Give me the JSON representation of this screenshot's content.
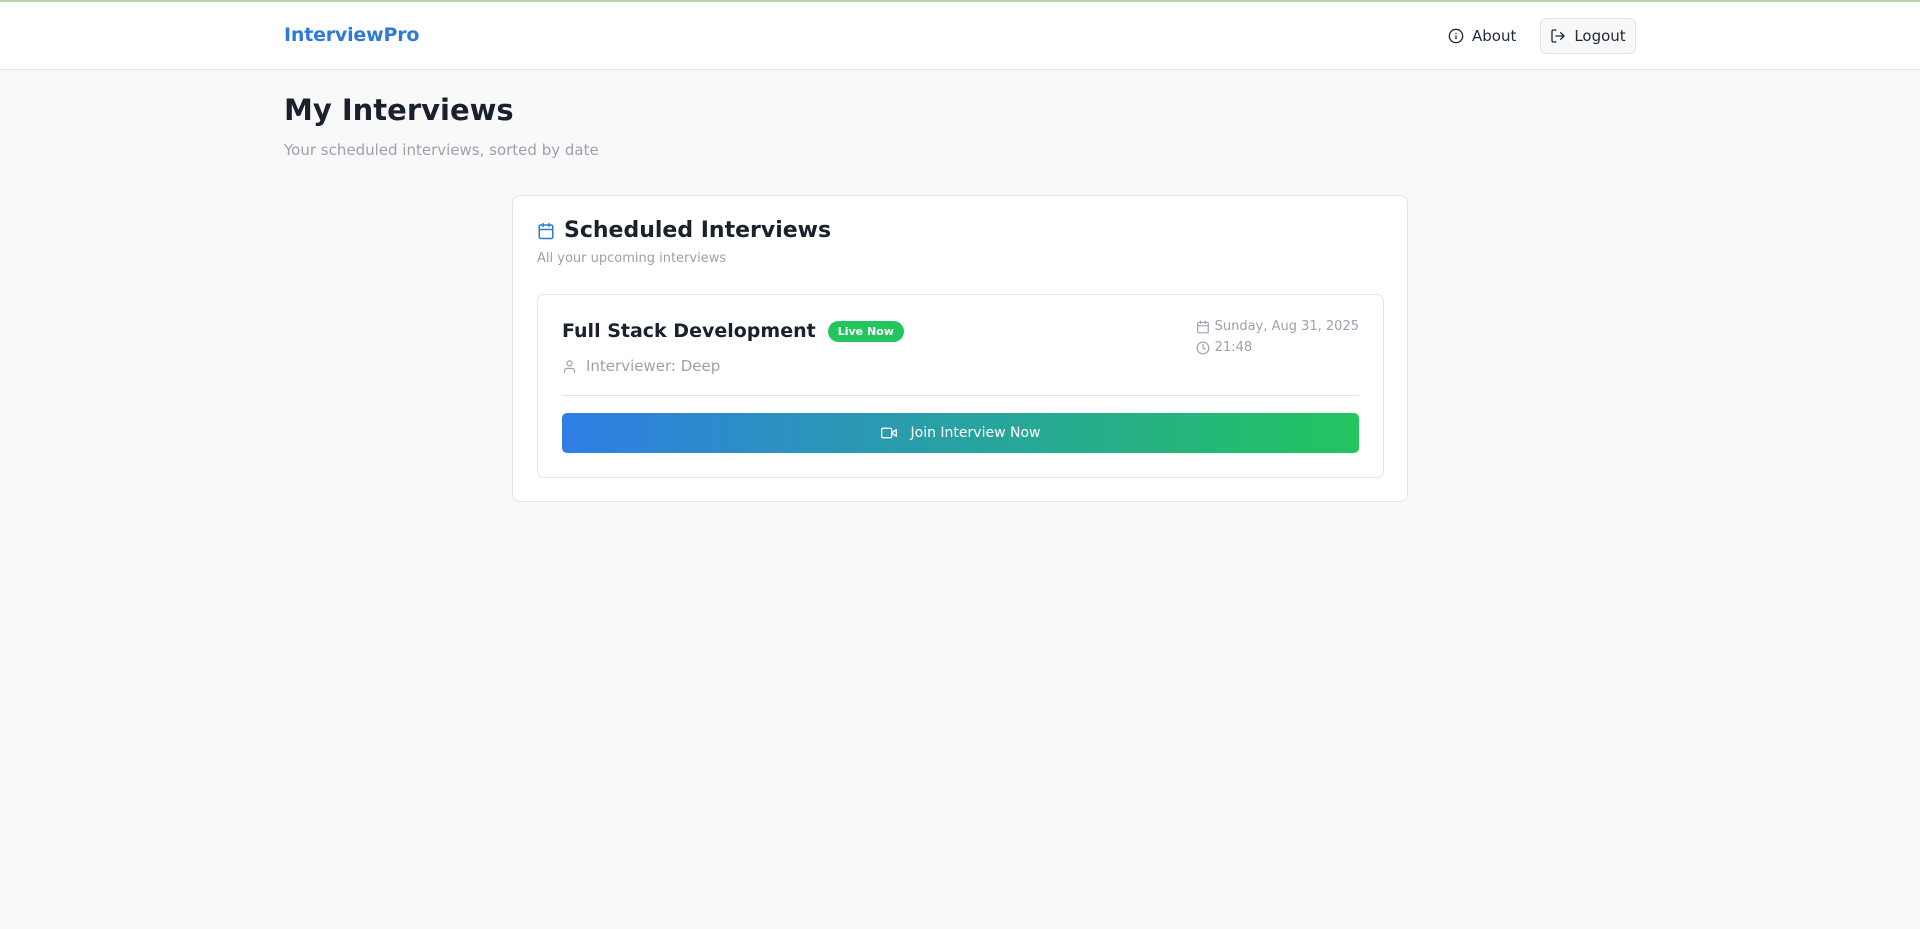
{
  "app": {
    "brand": "InterviewPro"
  },
  "nav": {
    "about_label": "About",
    "logout_label": "Logout"
  },
  "page": {
    "title": "My Interviews",
    "subtitle": "Your scheduled interviews, sorted by date"
  },
  "card": {
    "title": "Scheduled Interviews",
    "subtitle": "All your upcoming interviews",
    "icon": "calendar-icon"
  },
  "interviews": [
    {
      "title": "Full Stack Development",
      "badge": "Live Now",
      "interviewer": "Interviewer: Deep",
      "date": "Sunday, Aug 31, 2025",
      "time": "21:48",
      "join_label": "Join Interview Now"
    }
  ],
  "colors": {
    "brand": "#2f7ad9",
    "badge_green": "#22c55e",
    "gradient_start": "#2f7ee6",
    "gradient_end": "#22c55e"
  },
  "icons": {
    "about": "info-icon",
    "logout": "logout-icon",
    "interviewer": "user-icon",
    "date": "calendar-icon",
    "time": "clock-icon",
    "join": "video-icon"
  }
}
